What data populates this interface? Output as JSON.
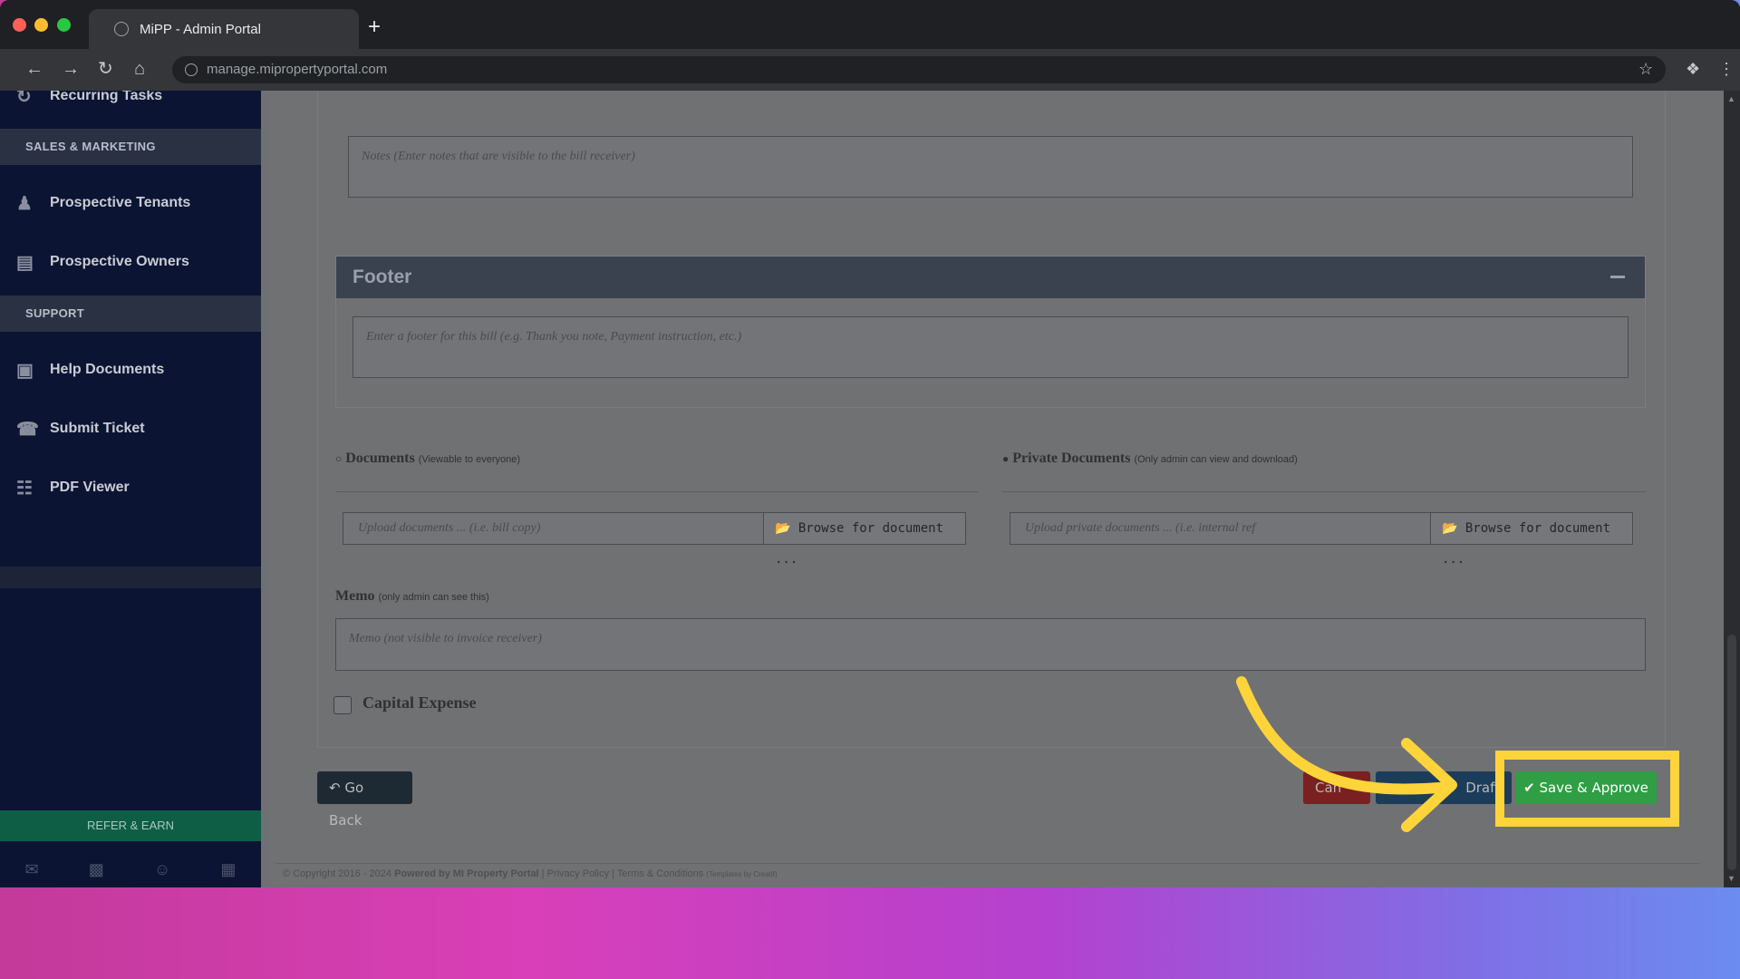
{
  "browser": {
    "tab_title": "MiPP - Admin Portal",
    "new_tab": "+",
    "url": "manage.mipropertyportal.com"
  },
  "sidebar": {
    "top_item": "Recurring Tasks",
    "section_sales": "SALES & MARKETING",
    "prospective_tenants": "Prospective Tenants",
    "prospective_owners": "Prospective Owners",
    "section_support": "SUPPORT",
    "help_documents": "Help Documents",
    "submit_ticket": "Submit Ticket",
    "pdf_viewer": "PDF Viewer",
    "refer_earn": "REFER & EARN"
  },
  "form": {
    "notes_placeholder": "Notes (Enter notes that are visible to the bill receiver)",
    "footer_title": "Footer",
    "footer_placeholder": "Enter a footer for this bill (e.g. Thank you note, Payment instruction, etc.)",
    "documents_label": "Documents",
    "documents_hint": "(Viewable to everyone)",
    "documents_placeholder": "Upload documents ... (i.e. bill copy)",
    "browse_label": "Browse for document ...",
    "private_documents_label": "Private Documents",
    "private_documents_hint": "(Only admin can view and download)",
    "private_documents_placeholder": "Upload private documents ... (i.e. internal ref",
    "memo_label": "Memo",
    "memo_hint": "(only admin can see this)",
    "memo_placeholder": "Memo (not visible to invoice receiver)",
    "capital_expense_label": "Capital Expense",
    "capital_expense_checked": false
  },
  "actions": {
    "go_back": "Go Back",
    "cancel_partial": "Can",
    "draft_partial": "Draft",
    "save_approve": "Save & Approve"
  },
  "footer": {
    "copyright": "© Copyright 2016 - 2024",
    "powered_by": "Powered by MI Property Portal",
    "privacy": "Privacy Policy",
    "terms": "Terms & Conditions",
    "templates": "(Templates by Creatif)"
  },
  "colors": {
    "highlight": "#ffd43b",
    "approve": "#2f9e44",
    "arrow": "#ffd43b"
  }
}
